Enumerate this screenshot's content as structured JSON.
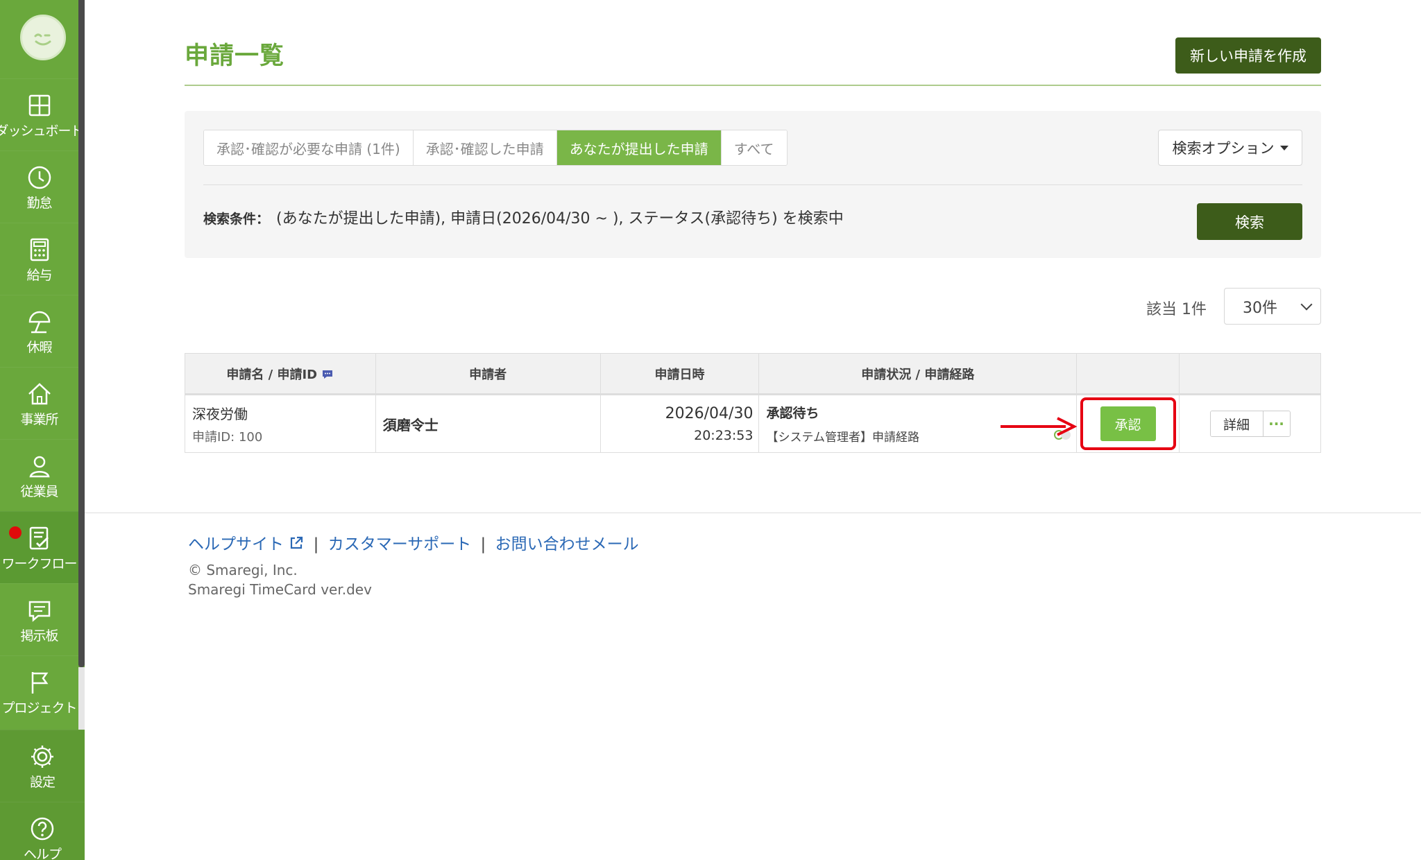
{
  "sidebar": {
    "items": [
      {
        "label": "ダッシュボード",
        "icon": "dashboard-icon"
      },
      {
        "label": "勤怠",
        "icon": "clock-icon"
      },
      {
        "label": "給与",
        "icon": "calculator-icon"
      },
      {
        "label": "休暇",
        "icon": "parasol-icon"
      },
      {
        "label": "事業所",
        "icon": "home-icon"
      },
      {
        "label": "従業員",
        "icon": "person-icon"
      },
      {
        "label": "ワークフロー",
        "icon": "workflow-icon"
      },
      {
        "label": "掲示板",
        "icon": "chat-icon"
      },
      {
        "label": "プロジェクト",
        "icon": "flag-icon"
      },
      {
        "label": "設定",
        "icon": "gear-icon"
      },
      {
        "label": "ヘルプ",
        "icon": "question-icon"
      }
    ]
  },
  "header": {
    "title": "申請一覧",
    "new_button": "新しい申請を作成"
  },
  "filters": {
    "tabs": [
      {
        "label": "承認･確認が必要な申請 (1件)"
      },
      {
        "label": "承認･確認した申請"
      },
      {
        "label": "あなたが提出した申請"
      },
      {
        "label": "すべて"
      }
    ],
    "active_tab": "あなたが提出した申請",
    "search_options_label": "検索オプション",
    "condition_label": "検索条件：",
    "condition_text": "(あなたが提出した申請), 申請日(2026/04/30 ~ ), ステータス(承認待ち) を検索中",
    "search_button": "検索"
  },
  "results": {
    "count_text": "該当 1件",
    "per_page": "30件"
  },
  "table": {
    "headers": [
      "申請名 / 申請ID",
      "申請者",
      "申請日時",
      "申請状況 / 申請経路",
      "",
      ""
    ],
    "rows": [
      {
        "name": "深夜労働",
        "id_text": "申請ID: 100",
        "applicant": "須磨令士",
        "date": "2026/04/30",
        "time": "20:23:53",
        "status": "承認待ち",
        "route": "【システム管理者】申請経路",
        "approve_label": "承認",
        "detail_label": "詳細",
        "more_label": "···"
      }
    ]
  },
  "footer": {
    "links": [
      "ヘルプサイト",
      "カスタマーサポート",
      "お問い合わせメール"
    ],
    "separator": "|",
    "copyright": "© Smaregi, Inc.",
    "version": "Smaregi TimeCard ver.dev"
  },
  "colors": {
    "sidebar": "#6aa83c",
    "brand_dark": "#3d5c1a",
    "accent": "#7ab648",
    "highlight": "#e60012"
  }
}
